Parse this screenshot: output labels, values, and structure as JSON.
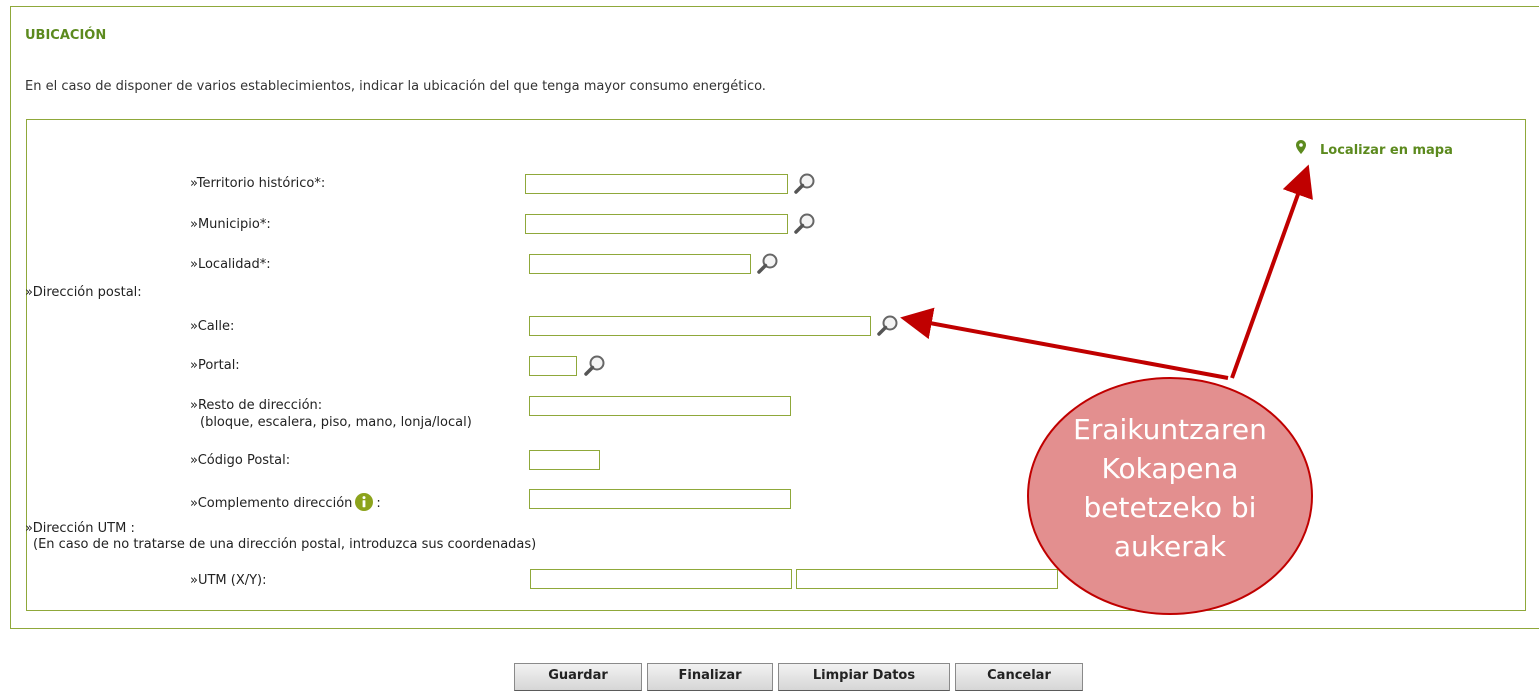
{
  "section": {
    "title": "UBICACIÓN",
    "intro": "En el caso de disponer de varios establecimientos, indicar la ubicación del que tenga mayor consumo energético."
  },
  "map_link": {
    "label": "Localizar en mapa",
    "icon": "map-pin-icon"
  },
  "fields": {
    "territorio": {
      "label": "»Territorio histórico*:",
      "value": ""
    },
    "municipio": {
      "label": "»Municipio*:",
      "value": ""
    },
    "localidad": {
      "label": "»Localidad*:",
      "value": ""
    },
    "direccion_postal": {
      "label": "»Dirección postal:"
    },
    "calle": {
      "label": "»Calle:",
      "value": ""
    },
    "portal": {
      "label": "»Portal:",
      "value": ""
    },
    "resto": {
      "label": "»Resto de dirección:",
      "hint": "(bloque, escalera, piso, mano, lonja/local)",
      "value": ""
    },
    "codigo_postal": {
      "label": "»Código Postal:",
      "value": ""
    },
    "complemento": {
      "label": "»Complemento dirección",
      "suffix": ":",
      "value": ""
    },
    "direccion_utm": {
      "label": "»Dirección UTM :",
      "hint": "(En caso de no tratarse de una dirección postal, introduzca sus coordenadas)"
    },
    "utm": {
      "label": "»UTM (X/Y):",
      "x_value": "",
      "y_value": ""
    }
  },
  "buttons": {
    "guardar": "Guardar",
    "finalizar": "Finalizar",
    "limpiar": "Limpiar Datos",
    "cancelar": "Cancelar"
  },
  "annotation": {
    "text": "Eraikuntzaren Kokapena betetzeko bi aukerak",
    "fill_color": "#e38f8f",
    "arrow_color": "#c00000"
  },
  "colors": {
    "accent": "#5c8a1e",
    "border": "#8fa83a"
  }
}
